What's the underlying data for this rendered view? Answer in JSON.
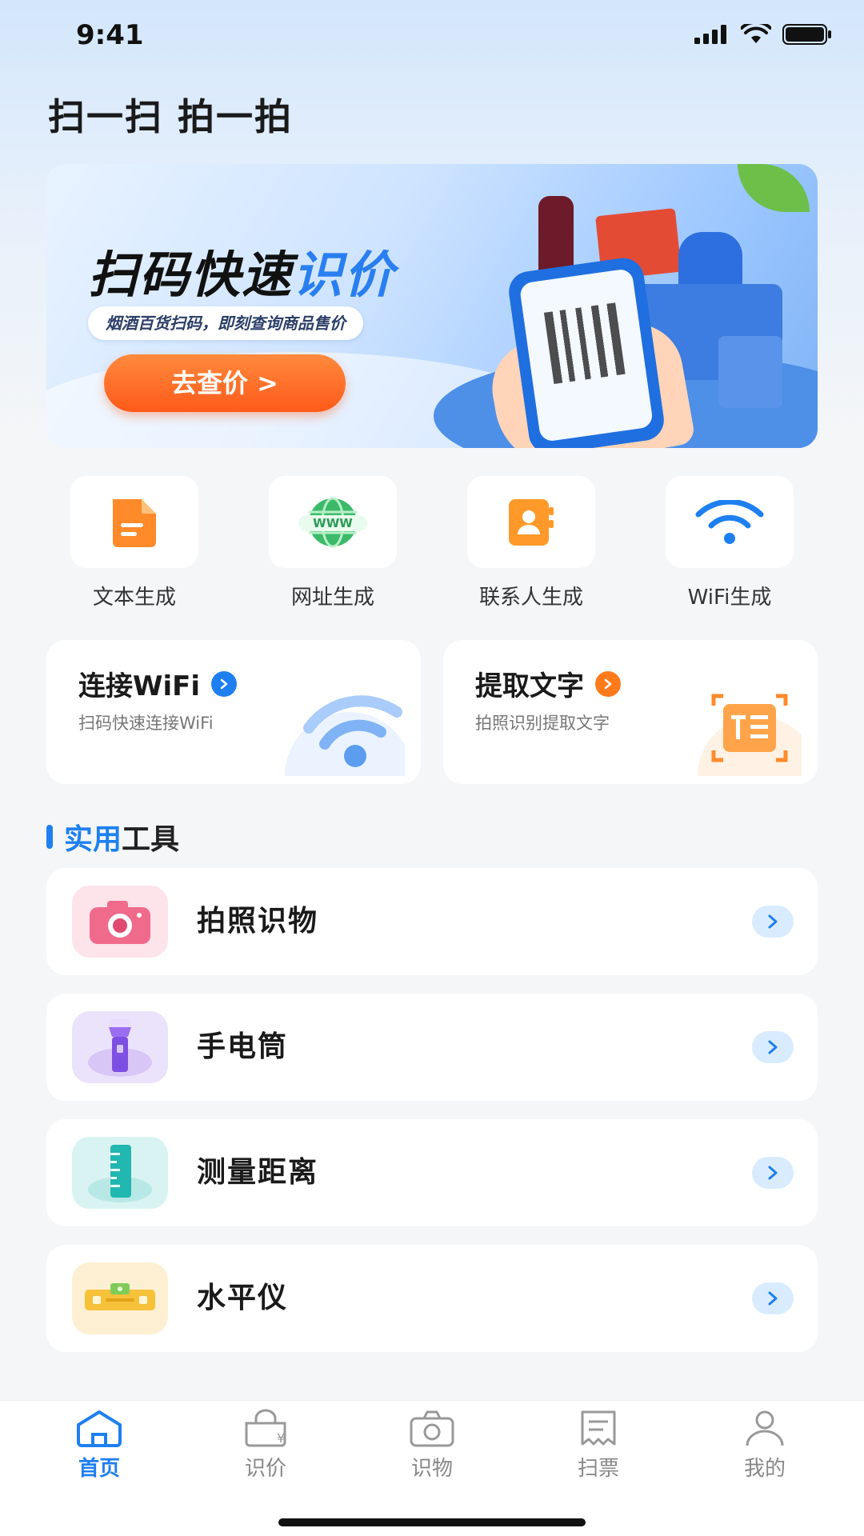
{
  "status_bar": {
    "time": "9:41"
  },
  "header": {
    "title": "扫一扫 拍一拍"
  },
  "banner": {
    "title_main": "扫码快速",
    "title_highlight": "识价",
    "subtitle": "烟酒百货扫码，即刻查询商品售价",
    "button_label": "去查价 >"
  },
  "quick_actions": [
    {
      "label": "文本生成",
      "icon": "document-icon"
    },
    {
      "label": "网址生成",
      "icon": "globe-www-icon"
    },
    {
      "label": "联系人生成",
      "icon": "contact-book-icon"
    },
    {
      "label": "WiFi生成",
      "icon": "wifi-icon"
    }
  ],
  "feature_cards": [
    {
      "title": "连接WiFi",
      "subtitle": "扫码快速连接WiFi",
      "accent": "#1e7ff0"
    },
    {
      "title": "提取文字",
      "subtitle": "拍照识别提取文字",
      "accent": "#ff7a1a"
    }
  ],
  "section": {
    "title_highlight": "实用",
    "title_rest": "工具"
  },
  "tools": [
    {
      "label": "拍照识物",
      "icon": "camera-icon"
    },
    {
      "label": "手电筒",
      "icon": "flashlight-icon"
    },
    {
      "label": "测量距离",
      "icon": "ruler-icon"
    },
    {
      "label": "水平仪",
      "icon": "spirit-level-icon"
    }
  ],
  "tab_bar": [
    {
      "label": "首页",
      "active": true
    },
    {
      "label": "识价",
      "active": false
    },
    {
      "label": "识物",
      "active": false
    },
    {
      "label": "扫票",
      "active": false
    },
    {
      "label": "我的",
      "active": false
    }
  ],
  "colors": {
    "accent": "#1e7ff0",
    "orange": "#ff5a1a",
    "background": "#f5f6f8"
  }
}
